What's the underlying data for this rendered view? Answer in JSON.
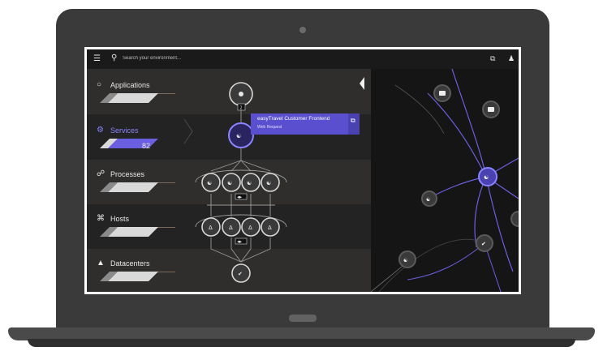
{
  "topbar": {
    "menu_icon": "hamburger-menu-icon",
    "search_icon": "search-icon",
    "search_placeholder": "Search your environment...",
    "share_icon": "external-link-icon",
    "user_icon": "user-icon"
  },
  "categories": [
    {
      "label": "Applications",
      "icon": "application-icon",
      "active": false
    },
    {
      "label": "Services",
      "icon": "gear-icon",
      "active": true,
      "count": "82"
    },
    {
      "label": "Processes",
      "icon": "process-icon",
      "active": false
    },
    {
      "label": "Hosts",
      "icon": "host-icon",
      "active": false
    },
    {
      "label": "Datacenters",
      "icon": "datacenter-icon",
      "active": false
    }
  ],
  "service_card": {
    "title": "easyTravel Customer Frontend",
    "subtitle": "Web Request"
  },
  "badges": {
    "app_count": "2"
  },
  "colors": {
    "accent": "#5a4fcf",
    "accent_text": "#8a84ff",
    "background": "#1b1b1b",
    "map_edge": "#6a5fe0"
  }
}
